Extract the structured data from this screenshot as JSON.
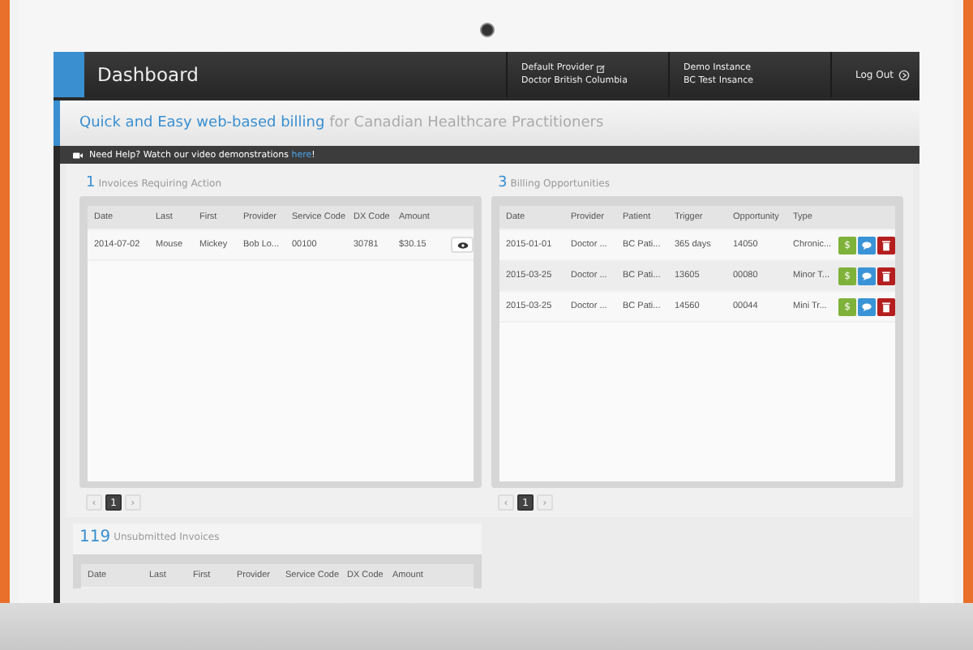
{
  "header": {
    "title": "Dashboard",
    "provider": {
      "label": "Default Provider",
      "name": "Doctor British Columbia"
    },
    "instance": {
      "label": "Demo Instance",
      "name": "BC Test Insance"
    },
    "logout": "Log Out"
  },
  "tagline": {
    "highlight": "Quick and Easy web-based billing",
    "rest": "for Canadian Healthcare Practitioners"
  },
  "help": {
    "text": "Need Help? Watch our video demonstrations ",
    "link": "here",
    "end": "!"
  },
  "invoices": {
    "count": "1",
    "label": "Invoices Requiring Action",
    "columns": [
      "Date",
      "Last",
      "First",
      "Provider",
      "Service Code",
      "DX Code",
      "Amount"
    ],
    "rows": [
      {
        "cells": [
          "2014-07-02",
          "Mouse",
          "Mickey",
          "Bob Lo...",
          "00100",
          "30781",
          "$30.15"
        ]
      }
    ],
    "pager": {
      "prev": "‹",
      "next": "›",
      "pages": [
        {
          "label": "1",
          "selected": true
        }
      ]
    }
  },
  "opportunities": {
    "count": "3",
    "label": "Billing Opportunities",
    "columns": [
      "Date",
      "Provider",
      "Patient",
      "Trigger",
      "Opportunity",
      "Type"
    ],
    "rows": [
      {
        "cells": [
          "2015-01-01",
          "Doctor ...",
          "BC Pati...",
          "365 days",
          "14050",
          "Chronic..."
        ],
        "actions": [
          {
            "kind": "bill",
            "label": "$"
          },
          {
            "kind": "message"
          },
          {
            "kind": "delete"
          }
        ]
      },
      {
        "cells": [
          "2015-03-25",
          "Doctor ...",
          "BC Pati...",
          "13605",
          "00080",
          "Minor T..."
        ],
        "actions": [
          {
            "kind": "bill",
            "label": "$"
          },
          {
            "kind": "message"
          },
          {
            "kind": "delete"
          }
        ]
      },
      {
        "cells": [
          "2015-03-25",
          "Doctor ...",
          "BC Pati...",
          "14560",
          "00044",
          "Mini Tr..."
        ],
        "actions": [
          {
            "kind": "bill",
            "label": "$"
          },
          {
            "kind": "message"
          },
          {
            "kind": "delete"
          }
        ]
      }
    ],
    "pager": {
      "prev": "‹",
      "next": "›",
      "pages": [
        {
          "label": "1",
          "selected": true
        }
      ]
    }
  },
  "unsubmitted": {
    "count": "119",
    "label": "Unsubmitted Invoices",
    "columns": [
      "Date",
      "Last",
      "First",
      "Provider",
      "Service Code",
      "DX Code",
      "Amount"
    ]
  }
}
